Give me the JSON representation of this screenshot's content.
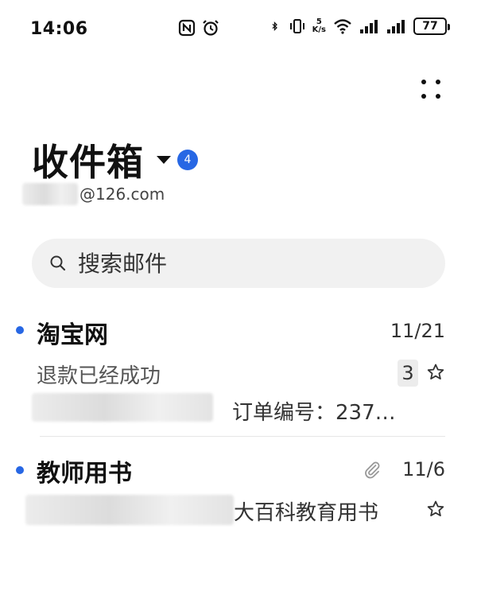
{
  "status_bar": {
    "time": "14:06",
    "left_icons": [
      "nfc-icon",
      "alarm-icon"
    ],
    "right_icons": [
      "bluetooth-icon",
      "vibrate-icon",
      "wifi-icon",
      "signal-icon",
      "signal-icon"
    ],
    "net_speed_value": "5",
    "net_speed_unit": "K/s",
    "battery": "77"
  },
  "header": {
    "more_icon": "more-dots-icon",
    "title": "收件箱",
    "unread_count": "4",
    "account_domain": "@126.com"
  },
  "search": {
    "placeholder": "搜索邮件"
  },
  "mails": [
    {
      "sender": "淘宝网",
      "date": "11/21",
      "subject": "退款已经成功",
      "thread_count": "3",
      "preview": "订单编号：237…",
      "unread": true,
      "has_attachment": false
    },
    {
      "sender": "教师用书",
      "date": "11/6",
      "subject": "",
      "preview": "大百科教育用书",
      "unread": true,
      "has_attachment": true
    }
  ],
  "colors": {
    "accent": "#2767e4",
    "search_bg": "#f1f1f1"
  }
}
